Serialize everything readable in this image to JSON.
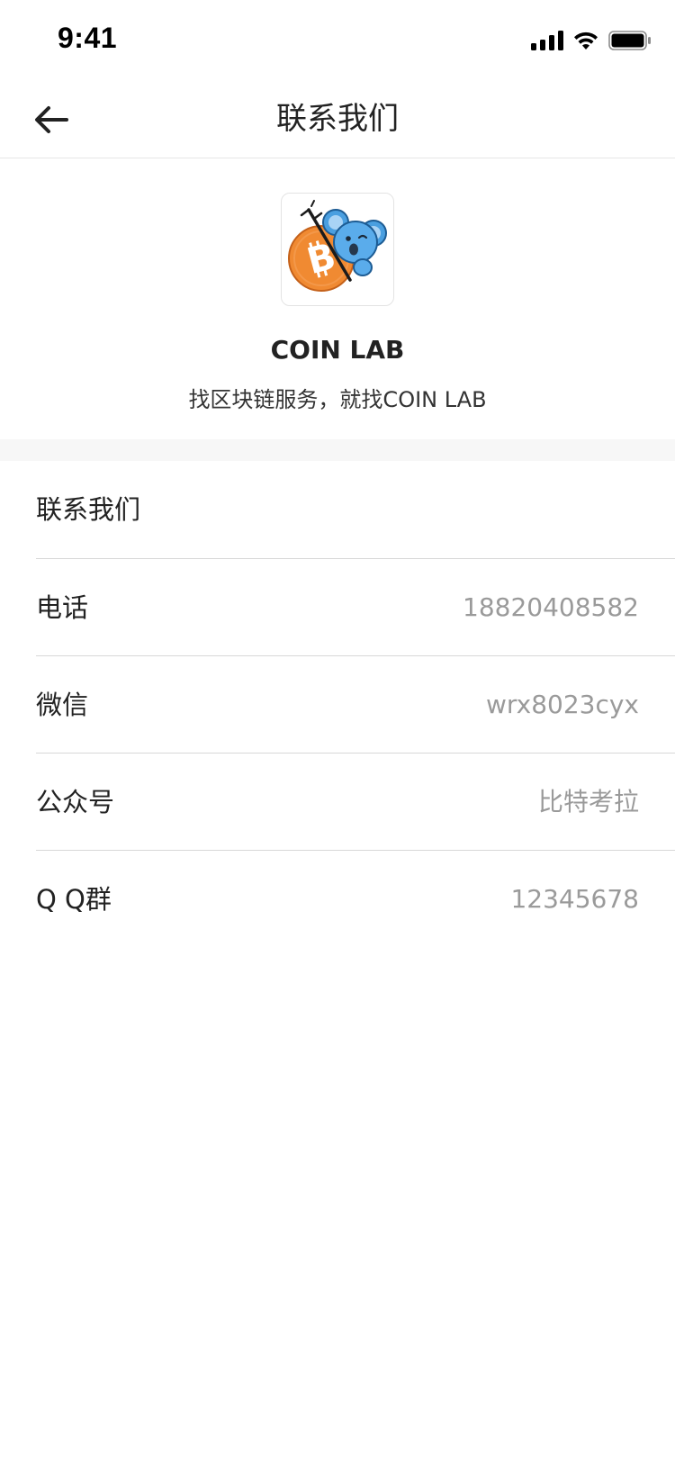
{
  "status_bar": {
    "time": "9:41",
    "icons": [
      "signal-icon",
      "wifi-icon",
      "battery-icon"
    ]
  },
  "nav": {
    "title": "联系我们",
    "back_icon": "arrow-left-icon"
  },
  "brand": {
    "logo_icon": "coin-lab-koala-logo",
    "name": "COIN LAB",
    "slogan": "找区块链服务，就找COIN LAB"
  },
  "contact": {
    "section_title": "联系我们",
    "rows": [
      {
        "label": "电话",
        "value": "18820408582"
      },
      {
        "label": "微信",
        "value": "wrx8023cyx"
      },
      {
        "label": "公众号",
        "value": "比特考拉"
      },
      {
        "label": "Q Q群",
        "value": "12345678"
      }
    ]
  },
  "colors": {
    "accent_orange": "#f08a32",
    "koala_blue": "#4a9fe0",
    "divider": "#d8d8d8",
    "value_gray": "#9a9a9a"
  }
}
